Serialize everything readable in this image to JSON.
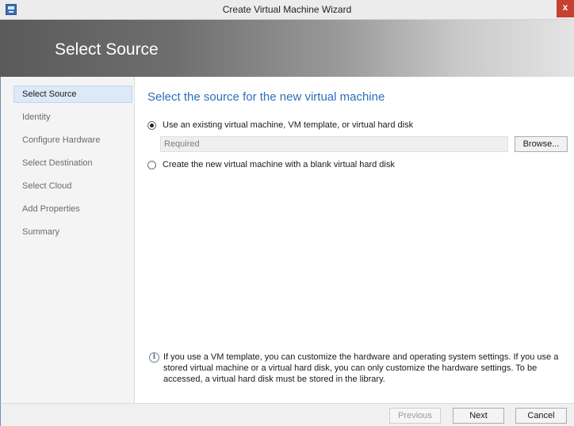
{
  "window": {
    "title": "Create Virtual Machine Wizard",
    "close_label": "x"
  },
  "banner": {
    "title": "Select Source"
  },
  "sidebar": {
    "items": [
      {
        "label": "Select Source",
        "active": true
      },
      {
        "label": "Identity",
        "active": false
      },
      {
        "label": "Configure Hardware",
        "active": false
      },
      {
        "label": "Select Destination",
        "active": false
      },
      {
        "label": "Select Cloud",
        "active": false
      },
      {
        "label": "Add Properties",
        "active": false
      },
      {
        "label": "Summary",
        "active": false
      }
    ]
  },
  "main": {
    "heading": "Select the source for the new virtual machine",
    "option_existing": {
      "label": "Use an existing virtual machine, VM template, or virtual hard disk",
      "selected": true
    },
    "source_field": {
      "placeholder": "Required",
      "value": ""
    },
    "browse_label": "Browse...",
    "option_blank": {
      "label": "Create the new virtual machine with a blank virtual hard disk",
      "selected": false
    },
    "info_text": "If you use a VM template, you can customize the hardware and operating system settings. If you use a stored virtual machine or a virtual hard disk, you can only customize the hardware settings. To be accessed, a virtual hard disk must be stored in the library."
  },
  "footer": {
    "previous_label": "Previous",
    "next_label": "Next",
    "cancel_label": "Cancel",
    "previous_enabled": false
  },
  "icons": {
    "app": "vm-wizard-icon",
    "close": "close-icon",
    "info": "info-icon"
  },
  "colors": {
    "heading": "#2c6fba",
    "active_nav_bg": "#dde9f7",
    "close_button": "#c84031"
  }
}
